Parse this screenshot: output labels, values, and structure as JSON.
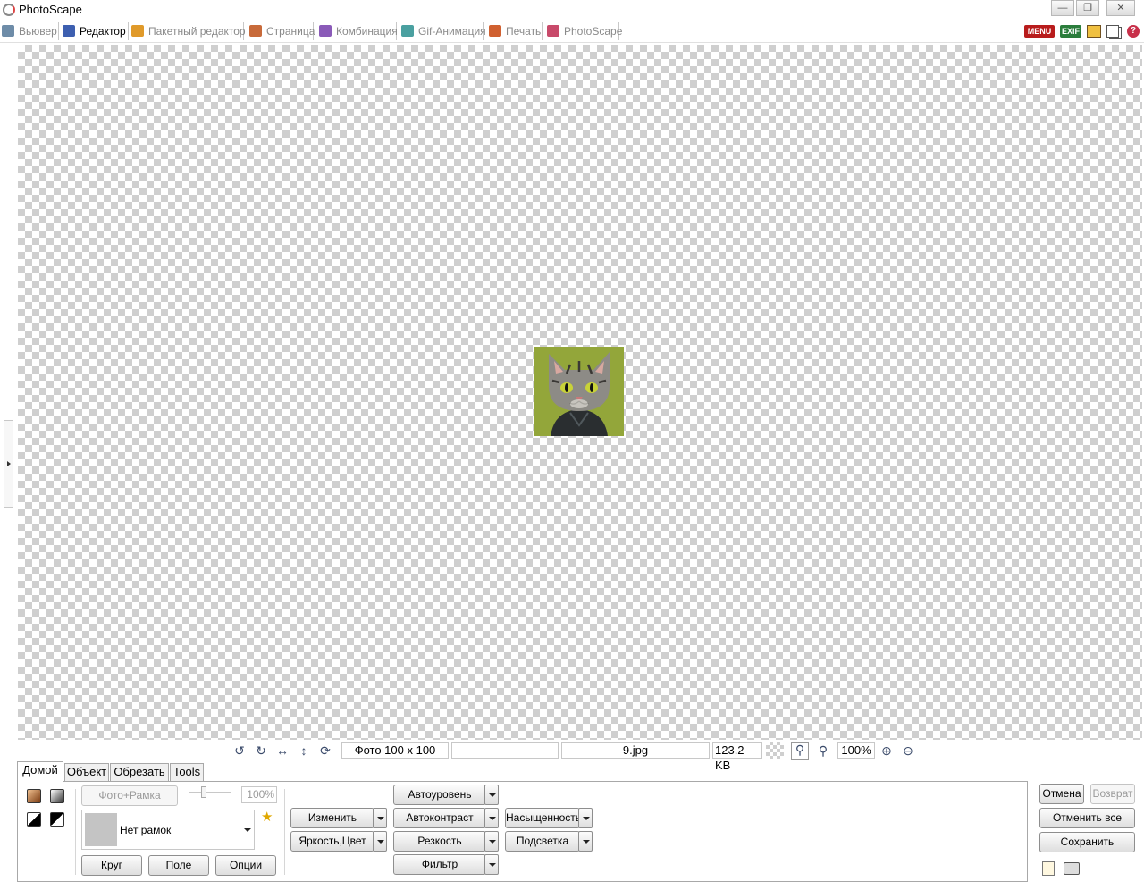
{
  "window": {
    "title": "PhotoScape",
    "controls": [
      "minimize-icon",
      "maximize-icon",
      "close-icon"
    ]
  },
  "main_tabs": [
    {
      "label": "Вьювер",
      "icon": "viewer-icon",
      "active": false
    },
    {
      "label": "Редактор",
      "icon": "editor-icon",
      "active": true
    },
    {
      "label": "Пакетный редактор",
      "icon": "batch-editor-icon",
      "active": false
    },
    {
      "label": "Страница",
      "icon": "page-icon",
      "active": false
    },
    {
      "label": "Комбинация",
      "icon": "combine-icon",
      "active": false
    },
    {
      "label": "Gif-Анимация",
      "icon": "gif-icon",
      "active": false
    },
    {
      "label": "Печать",
      "icon": "print-icon",
      "active": false
    },
    {
      "label": "PhotoScape",
      "icon": "photoscape-icon",
      "active": false
    }
  ],
  "top_right": {
    "menu_label": "MENU",
    "exif_label": "EXIF",
    "icons": [
      "folder-icon",
      "copy-icon",
      "help-icon"
    ]
  },
  "canvas": {
    "background": "transparency-checkerboard",
    "photo_subject": "cat-in-hoodie"
  },
  "status": {
    "icons": [
      "rotate-left-icon",
      "rotate-right-icon",
      "flip-horizontal-icon",
      "flip-vertical-icon",
      "refresh-icon"
    ],
    "photo_size": "Фото 100 x 100",
    "empty_field": "",
    "filename": "9.jpg",
    "filesize": "123.2 KB",
    "zoom": "100%",
    "zoom_icons": [
      "zoom-fit-icon",
      "zoom-actual-icon",
      "zoom-in-icon",
      "zoom-out-icon"
    ]
  },
  "panel_tabs": [
    {
      "label": "Домой",
      "active": true
    },
    {
      "label": "Объект",
      "active": false
    },
    {
      "label": "Обрезать",
      "active": false
    },
    {
      "label": "Tools",
      "active": false
    }
  ],
  "home": {
    "photo_frame_button": "Фото+Рамка",
    "opacity_value": "100%",
    "frame_select": "Нет рамок",
    "round_button": "Круг",
    "margin_button": "Поле",
    "options_button": "Опции",
    "resize_button": "Изменить",
    "brightness_button": "Яркость,Цвет",
    "autolevel_button": "Автоуровень",
    "autocontrast_button": "Автоконтраст",
    "sharpen_button": "Резкость",
    "filter_button": "Фильтр",
    "saturation_button": "Насыщенность",
    "backlight_button": "Подсветка"
  },
  "actions": {
    "undo_button": "Отмена",
    "redo_button": "Возврат",
    "undo_all_button": "Отменить все",
    "save_button": "Сохранить"
  },
  "colors": {
    "accent_menu": "#b81c1c",
    "exif_green": "#2b7d3c",
    "checker": "#cfcfcf",
    "photo_bg": "#93a63a"
  }
}
